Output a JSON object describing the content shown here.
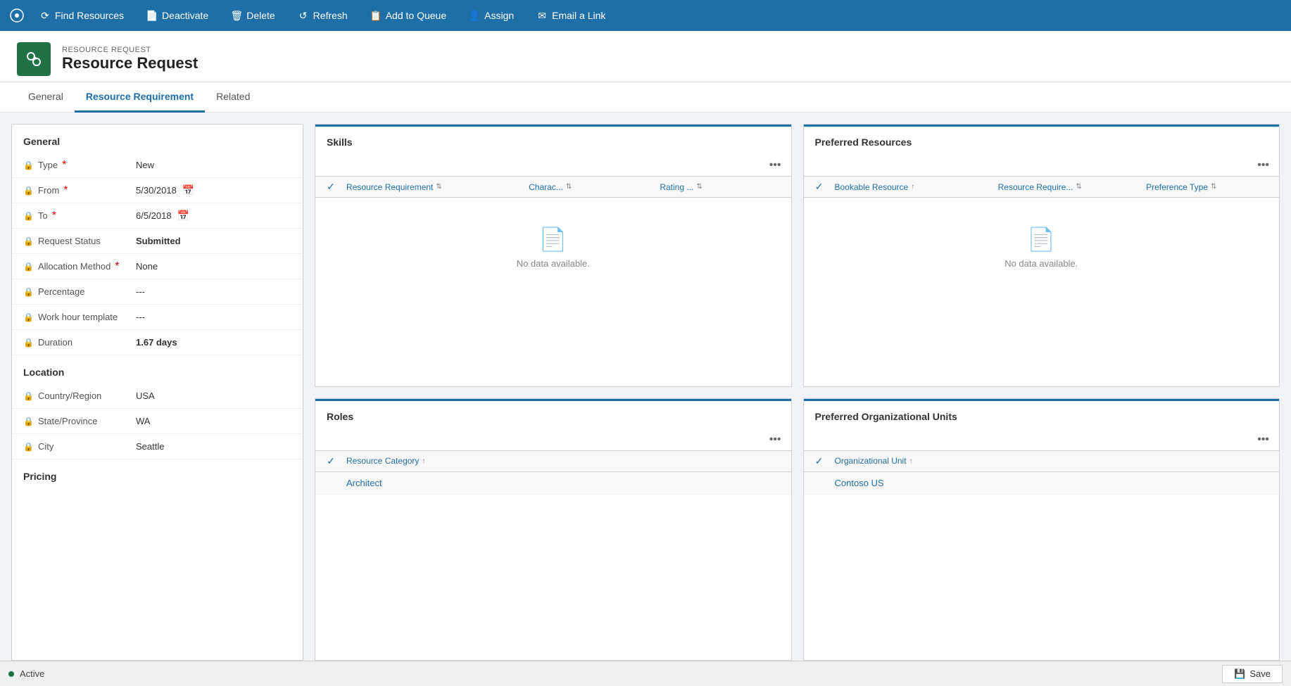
{
  "topbar": {
    "buttons": [
      {
        "id": "find-resources",
        "label": "Find Resources",
        "icon": "⟳"
      },
      {
        "id": "deactivate",
        "label": "Deactivate",
        "icon": "📄"
      },
      {
        "id": "delete",
        "label": "Delete",
        "icon": "🗑"
      },
      {
        "id": "refresh",
        "label": "Refresh",
        "icon": "↺"
      },
      {
        "id": "add-to-queue",
        "label": "Add to Queue",
        "icon": "📋"
      },
      {
        "id": "assign",
        "label": "Assign",
        "icon": "👤"
      },
      {
        "id": "email-a-link",
        "label": "Email a Link",
        "icon": "✉"
      }
    ]
  },
  "header": {
    "entity_label": "RESOURCE REQUEST",
    "entity_title": "Resource Request",
    "entity_icon": "🔗"
  },
  "tabs": [
    {
      "id": "general",
      "label": "General",
      "active": false
    },
    {
      "id": "resource-requirement",
      "label": "Resource Requirement",
      "active": true
    },
    {
      "id": "related",
      "label": "Related",
      "active": false
    }
  ],
  "left_panel": {
    "sections": [
      {
        "id": "general",
        "title": "General",
        "fields": [
          {
            "id": "type",
            "label": "Type",
            "value": "New",
            "required": true,
            "locked": true,
            "bold": false
          },
          {
            "id": "from",
            "label": "From",
            "value": "5/30/2018",
            "required": true,
            "locked": true,
            "has_calendar": true
          },
          {
            "id": "to",
            "label": "To",
            "value": "6/5/2018",
            "required": true,
            "locked": true,
            "has_calendar": true
          },
          {
            "id": "request-status",
            "label": "Request Status",
            "value": "Submitted",
            "required": false,
            "locked": true,
            "bold": true
          },
          {
            "id": "allocation-method",
            "label": "Allocation Method",
            "value": "None",
            "required": true,
            "locked": true,
            "bold": false
          },
          {
            "id": "percentage",
            "label": "Percentage",
            "value": "---",
            "required": false,
            "locked": true
          },
          {
            "id": "work-hour-template",
            "label": "Work hour template",
            "value": "---",
            "required": false,
            "locked": true
          },
          {
            "id": "duration",
            "label": "Duration",
            "value": "1.67 days",
            "required": false,
            "locked": true,
            "bold": true
          }
        ]
      },
      {
        "id": "location",
        "title": "Location",
        "fields": [
          {
            "id": "country-region",
            "label": "Country/Region",
            "value": "USA",
            "required": false,
            "locked": true
          },
          {
            "id": "state-province",
            "label": "State/Province",
            "value": "WA",
            "required": false,
            "locked": true
          },
          {
            "id": "city",
            "label": "City",
            "value": "Seattle",
            "required": false,
            "locked": true
          }
        ]
      },
      {
        "id": "pricing",
        "title": "Pricing",
        "fields": []
      }
    ]
  },
  "skills_panel": {
    "title": "Skills",
    "columns": [
      {
        "id": "resource-requirement",
        "label": "Resource Requirement"
      },
      {
        "id": "characteristics",
        "label": "Charac..."
      },
      {
        "id": "rating",
        "label": "Rating ..."
      }
    ],
    "no_data_text": "No data available.",
    "rows": []
  },
  "roles_panel": {
    "title": "Roles",
    "columns": [
      {
        "id": "resource-category",
        "label": "Resource Category"
      }
    ],
    "rows": [
      {
        "id": "architect",
        "resource_category": "Architect"
      }
    ]
  },
  "preferred_resources_panel": {
    "title": "Preferred Resources",
    "columns": [
      {
        "id": "bookable-resource",
        "label": "Bookable Resource"
      },
      {
        "id": "resource-require",
        "label": "Resource Require..."
      },
      {
        "id": "preference-type",
        "label": "Preference Type"
      }
    ],
    "no_data_text": "No data available.",
    "rows": []
  },
  "preferred_org_units_panel": {
    "title": "Preferred Organizational Units",
    "columns": [
      {
        "id": "organizational-unit",
        "label": "Organizational Unit"
      }
    ],
    "rows": [
      {
        "id": "contoso-us",
        "organizational_unit": "Contoso US"
      }
    ]
  },
  "statusbar": {
    "status": "Active",
    "save_label": "Save"
  }
}
